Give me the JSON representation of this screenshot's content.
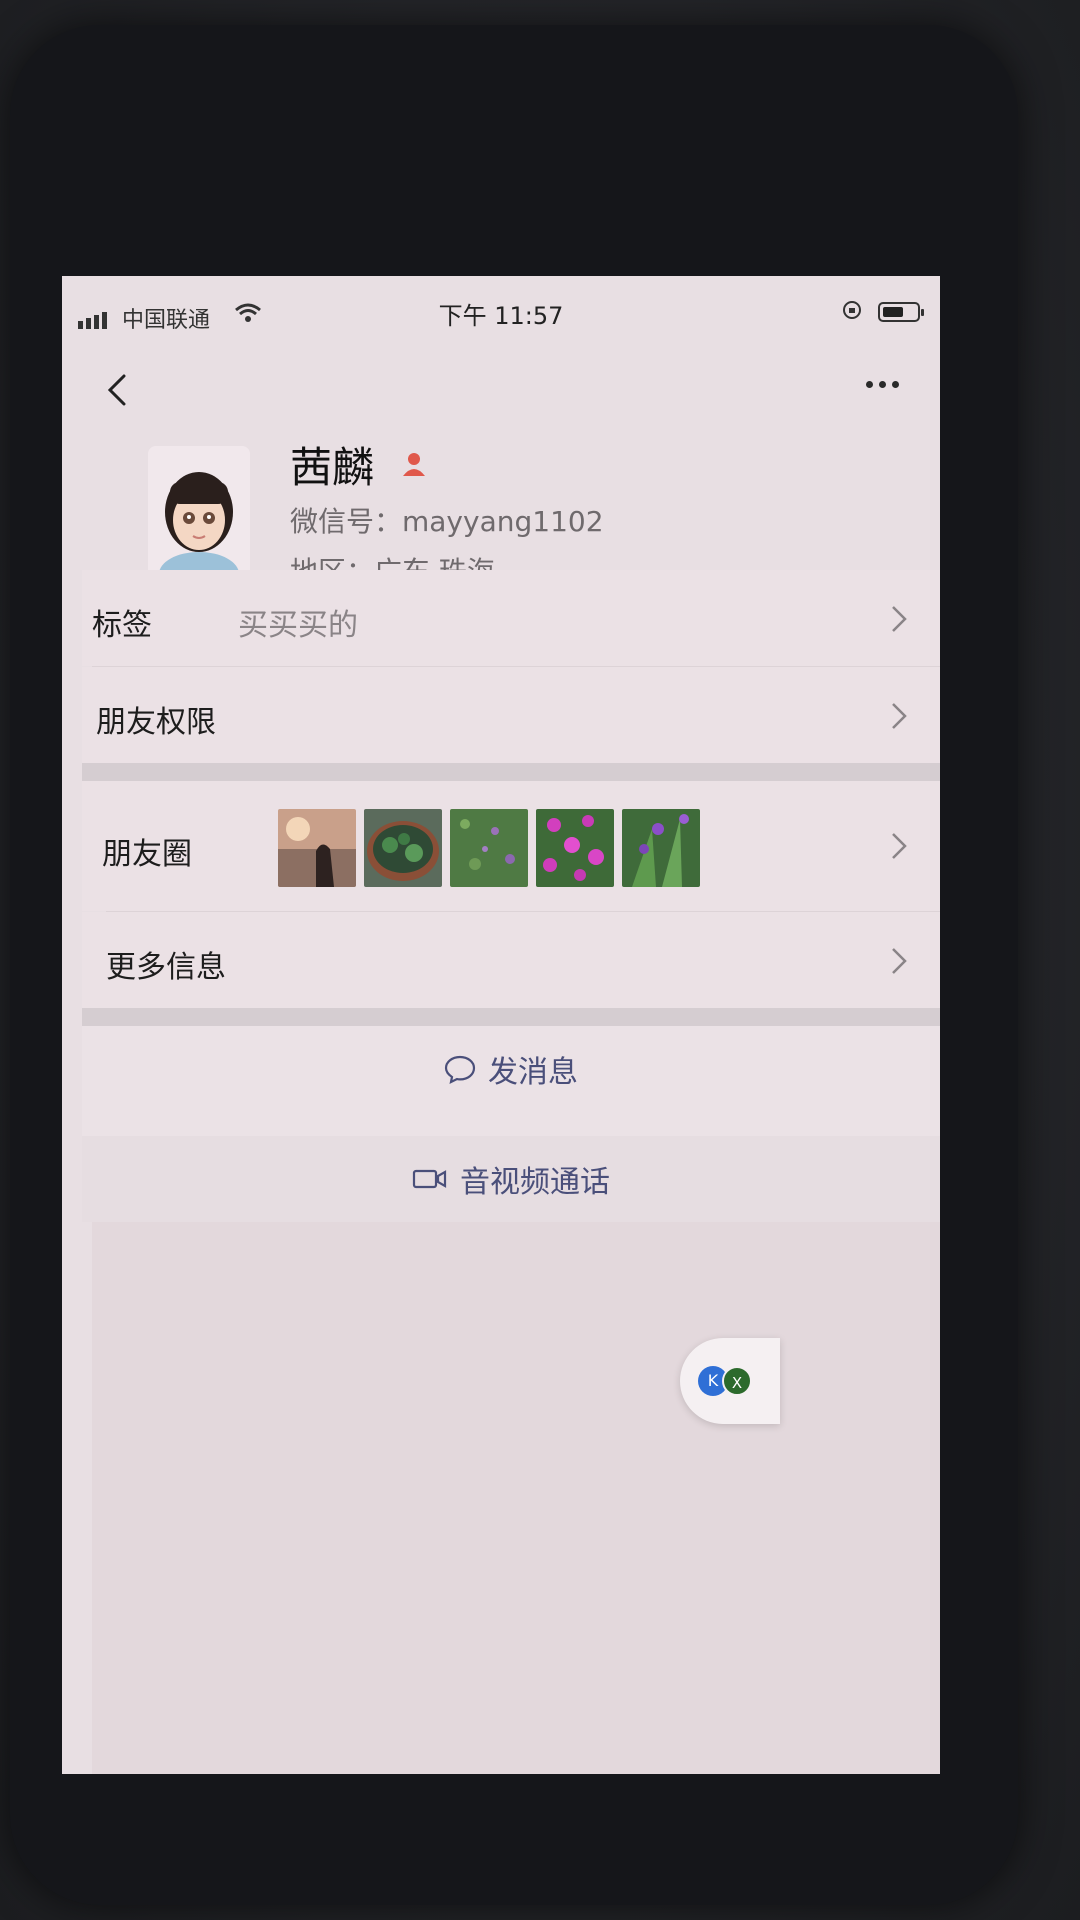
{
  "status_bar": {
    "carrier": "中国联通",
    "time": "下午 11:57"
  },
  "profile": {
    "name": "茜麟",
    "wechat_id": "微信号：mayyang1102",
    "region": "地区：广东 珠海"
  },
  "rows": {
    "tags": {
      "label": "标签",
      "value": "买买买的"
    },
    "permissions": {
      "label": "朋友权限"
    },
    "moments": {
      "label": "朋友圈"
    },
    "more_info": {
      "label": "更多信息"
    }
  },
  "actions": {
    "send_message": "发消息",
    "video_call": "音视频通话"
  },
  "floating_widget": {
    "badge": "X"
  },
  "colors": {
    "accent_text": "#4a4f7a",
    "tag_icon": "#e0584b"
  }
}
